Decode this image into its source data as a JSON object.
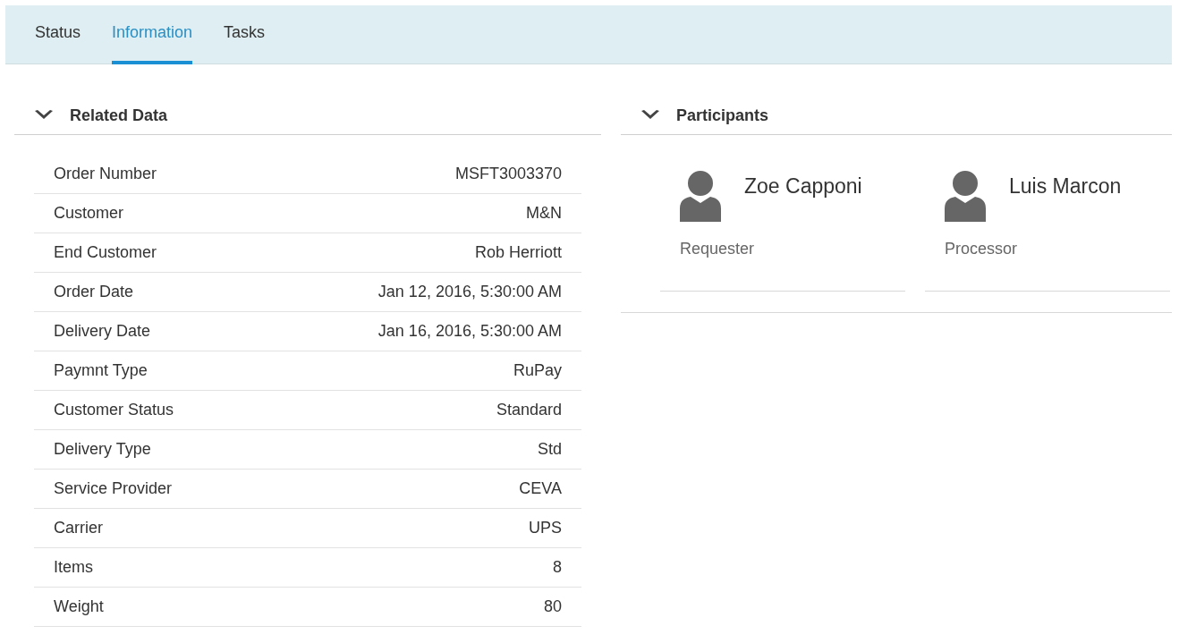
{
  "tabs": [
    {
      "label": "Status",
      "selected": false
    },
    {
      "label": "Information",
      "selected": true
    },
    {
      "label": "Tasks",
      "selected": false
    }
  ],
  "related_data": {
    "title": "Related Data",
    "expanded": true,
    "rows": [
      {
        "label": "Order Number",
        "value": "MSFT3003370"
      },
      {
        "label": "Customer",
        "value": "M&N"
      },
      {
        "label": "End Customer",
        "value": "Rob Herriott"
      },
      {
        "label": "Order Date",
        "value": "Jan 12, 2016, 5:30:00 AM"
      },
      {
        "label": "Delivery Date",
        "value": "Jan 16, 2016, 5:30:00 AM"
      },
      {
        "label": "Paymnt Type",
        "value": "RuPay"
      },
      {
        "label": "Customer Status",
        "value": "Standard"
      },
      {
        "label": "Delivery Type",
        "value": "Std"
      },
      {
        "label": "Service Provider",
        "value": "CEVA"
      },
      {
        "label": "Carrier",
        "value": "UPS"
      },
      {
        "label": "Items",
        "value": "8"
      },
      {
        "label": "Weight",
        "value": "80"
      }
    ]
  },
  "participants": {
    "title": "Participants",
    "expanded": true,
    "people": [
      {
        "name": "Zoe Capponi",
        "role": "Requester"
      },
      {
        "name": "Luis Marcon",
        "role": "Processor"
      }
    ]
  }
}
